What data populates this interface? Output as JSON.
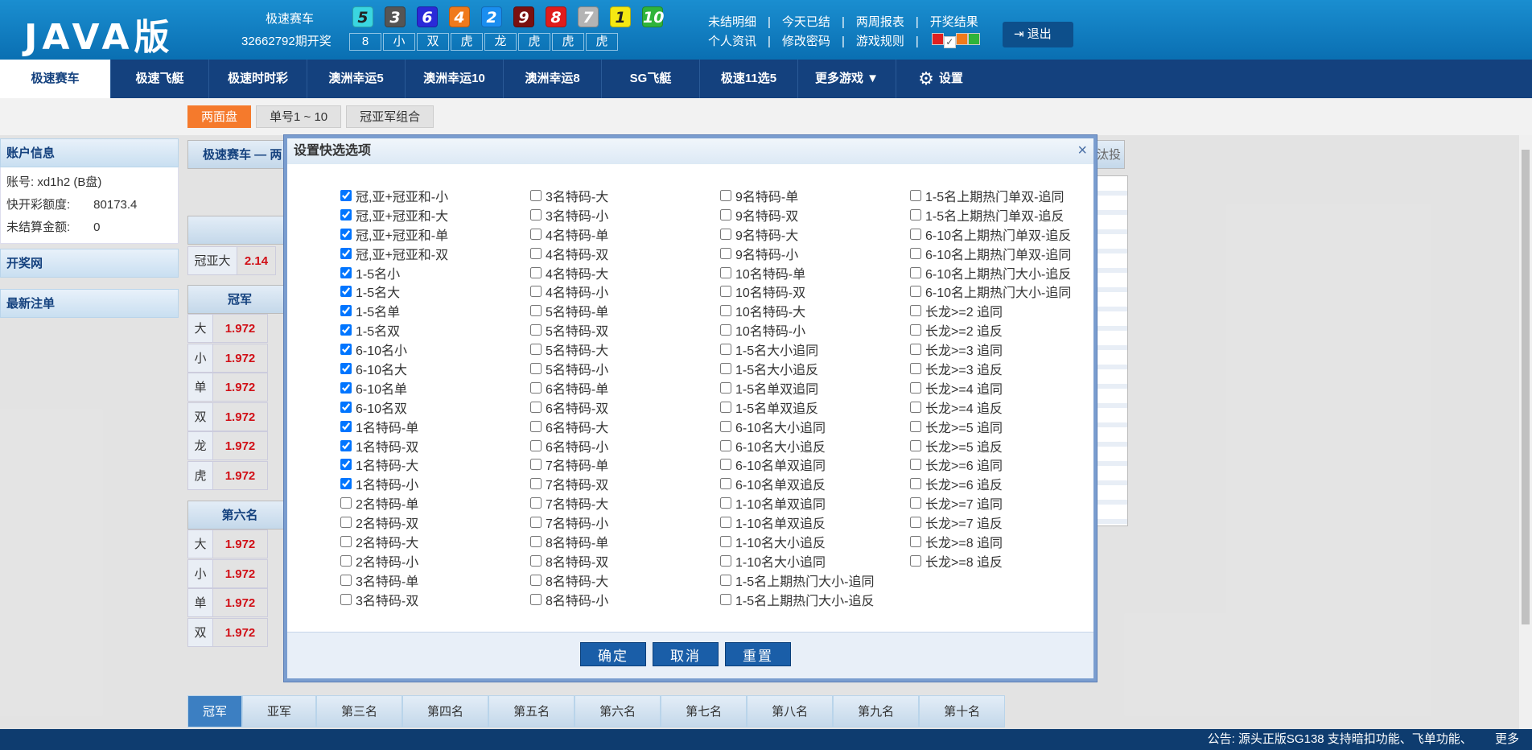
{
  "header": {
    "logo": "JAVA版",
    "game_name": "极速赛车",
    "draw_period": "32662792期开奖",
    "balls": [
      {
        "n": "5",
        "color": "#3ad6e0"
      },
      {
        "n": "3",
        "color": "#555555"
      },
      {
        "n": "6",
        "color": "#2a2ad8"
      },
      {
        "n": "4",
        "color": "#f07a1c"
      },
      {
        "n": "2",
        "color": "#1a8ef0"
      },
      {
        "n": "9",
        "color": "#7a1010"
      },
      {
        "n": "8",
        "color": "#e01c1c"
      },
      {
        "n": "7",
        "color": "#b4b4b4"
      },
      {
        "n": "1",
        "color": "#f5e812"
      },
      {
        "n": "10",
        "color": "#2fb43a"
      }
    ],
    "results": [
      "8",
      "小",
      "双",
      "虎",
      "龙",
      "虎",
      "虎",
      "虎"
    ],
    "links_row1": [
      "未结明细",
      "今天已结",
      "两周报表",
      "开奖结果"
    ],
    "links_row2": [
      "个人资讯",
      "修改密码",
      "游戏规则"
    ],
    "swatch_colors": [
      "#e02020",
      "#ffffff",
      "#f07a1c",
      "#2fb43a"
    ],
    "logout_label": "退出"
  },
  "nav": {
    "items": [
      "极速赛车",
      "极速飞艇",
      "极速时时彩",
      "澳洲幸运5",
      "澳洲幸运10",
      "澳洲幸运8",
      "SG飞艇",
      "极速11选5",
      "更多游戏 ▼"
    ],
    "settings_label": "设置"
  },
  "subtabs": [
    "两面盘",
    "单号1 ~ 10",
    "冠亚军组合"
  ],
  "sidebar": {
    "account_title": "账户信息",
    "account_label": "账号:",
    "account_value": "xd1h2 (B盘)",
    "credit_label": "快开彩额度:",
    "credit_value": "80173.4",
    "unsettled_label": "未结算金额:",
    "unsettled_value": "0",
    "lottery_site": "开奖网",
    "latest_bets": "最新注单"
  },
  "background": {
    "breadcrumb": "极速赛车 — 两",
    "right_tag": "汰投",
    "guanya_da_label": "冠亚大",
    "guanya_da_value": "2.14",
    "champion": "冠军",
    "sixth": "第六名",
    "champ_rows": [
      {
        "k": "大",
        "v": "1.972"
      },
      {
        "k": "小",
        "v": "1.972"
      },
      {
        "k": "单",
        "v": "1.972"
      },
      {
        "k": "双",
        "v": "1.972"
      },
      {
        "k": "龙",
        "v": "1.972"
      },
      {
        "k": "虎",
        "v": "1.972"
      }
    ],
    "sixth_rows": [
      {
        "k": "大",
        "v": "1.972"
      },
      {
        "k": "小",
        "v": "1.972"
      },
      {
        "k": "单",
        "v": "1.972"
      },
      {
        "k": "双",
        "v": "1.972"
      }
    ]
  },
  "bottom_tabs": [
    "冠军",
    "亚军",
    "第三名",
    "第四名",
    "第五名",
    "第六名",
    "第七名",
    "第八名",
    "第九名",
    "第十名"
  ],
  "status": {
    "notice": "公告: 源头正版SG138 支持暗扣功能、飞单功能、",
    "more": "更多"
  },
  "modal": {
    "title": "设置快选选项",
    "close": "×",
    "columns": [
      [
        {
          "label": "冠,亚+冠亚和-小",
          "checked": true
        },
        {
          "label": "冠,亚+冠亚和-大",
          "checked": true
        },
        {
          "label": "冠,亚+冠亚和-单",
          "checked": true
        },
        {
          "label": "冠,亚+冠亚和-双",
          "checked": true
        },
        {
          "label": "1-5名小",
          "checked": true
        },
        {
          "label": "1-5名大",
          "checked": true
        },
        {
          "label": "1-5名单",
          "checked": true
        },
        {
          "label": "1-5名双",
          "checked": true
        },
        {
          "label": "6-10名小",
          "checked": true
        },
        {
          "label": "6-10名大",
          "checked": true
        },
        {
          "label": "6-10名单",
          "checked": true
        },
        {
          "label": "6-10名双",
          "checked": true
        },
        {
          "label": "1名特码-单",
          "checked": true
        },
        {
          "label": "1名特码-双",
          "checked": true
        },
        {
          "label": "1名特码-大",
          "checked": true
        },
        {
          "label": "1名特码-小",
          "checked": true
        },
        {
          "label": "2名特码-单",
          "checked": false
        },
        {
          "label": "2名特码-双",
          "checked": false
        },
        {
          "label": "2名特码-大",
          "checked": false
        },
        {
          "label": "2名特码-小",
          "checked": false
        },
        {
          "label": "3名特码-单",
          "checked": false
        },
        {
          "label": "3名特码-双",
          "checked": false
        }
      ],
      [
        {
          "label": "3名特码-大",
          "checked": false
        },
        {
          "label": "3名特码-小",
          "checked": false
        },
        {
          "label": "4名特码-单",
          "checked": false
        },
        {
          "label": "4名特码-双",
          "checked": false
        },
        {
          "label": "4名特码-大",
          "checked": false
        },
        {
          "label": "4名特码-小",
          "checked": false
        },
        {
          "label": "5名特码-单",
          "checked": false
        },
        {
          "label": "5名特码-双",
          "checked": false
        },
        {
          "label": "5名特码-大",
          "checked": false
        },
        {
          "label": "5名特码-小",
          "checked": false
        },
        {
          "label": "6名特码-单",
          "checked": false
        },
        {
          "label": "6名特码-双",
          "checked": false
        },
        {
          "label": "6名特码-大",
          "checked": false
        },
        {
          "label": "6名特码-小",
          "checked": false
        },
        {
          "label": "7名特码-单",
          "checked": false
        },
        {
          "label": "7名特码-双",
          "checked": false
        },
        {
          "label": "7名特码-大",
          "checked": false
        },
        {
          "label": "7名特码-小",
          "checked": false
        },
        {
          "label": "8名特码-单",
          "checked": false
        },
        {
          "label": "8名特码-双",
          "checked": false
        },
        {
          "label": "8名特码-大",
          "checked": false
        },
        {
          "label": "8名特码-小",
          "checked": false
        }
      ],
      [
        {
          "label": "9名特码-单",
          "checked": false
        },
        {
          "label": "9名特码-双",
          "checked": false
        },
        {
          "label": "9名特码-大",
          "checked": false
        },
        {
          "label": "9名特码-小",
          "checked": false
        },
        {
          "label": "10名特码-单",
          "checked": false
        },
        {
          "label": "10名特码-双",
          "checked": false
        },
        {
          "label": "10名特码-大",
          "checked": false
        },
        {
          "label": "10名特码-小",
          "checked": false
        },
        {
          "label": "1-5名大小追同",
          "checked": false
        },
        {
          "label": "1-5名大小追反",
          "checked": false
        },
        {
          "label": "1-5名单双追同",
          "checked": false
        },
        {
          "label": "1-5名单双追反",
          "checked": false
        },
        {
          "label": "6-10名大小追同",
          "checked": false
        },
        {
          "label": "6-10名大小追反",
          "checked": false
        },
        {
          "label": "6-10名单双追同",
          "checked": false
        },
        {
          "label": "6-10名单双追反",
          "checked": false
        },
        {
          "label": "1-10名单双追同",
          "checked": false
        },
        {
          "label": "1-10名单双追反",
          "checked": false
        },
        {
          "label": "1-10名大小追反",
          "checked": false
        },
        {
          "label": "1-10名大小追同",
          "checked": false
        },
        {
          "label": "1-5名上期热门大小-追同",
          "checked": false
        },
        {
          "label": "1-5名上期热门大小-追反",
          "checked": false
        }
      ],
      [
        {
          "label": "1-5名上期热门单双-追同",
          "checked": false
        },
        {
          "label": "1-5名上期热门单双-追反",
          "checked": false
        },
        {
          "label": "6-10名上期热门单双-追反",
          "checked": false
        },
        {
          "label": "6-10名上期热门单双-追同",
          "checked": false
        },
        {
          "label": "6-10名上期热门大小-追反",
          "checked": false
        },
        {
          "label": "6-10名上期热门大小-追同",
          "checked": false
        },
        {
          "label": "长龙>=2 追同",
          "checked": false
        },
        {
          "label": "长龙>=2 追反",
          "checked": false
        },
        {
          "label": "长龙>=3 追同",
          "checked": false
        },
        {
          "label": "长龙>=3 追反",
          "checked": false
        },
        {
          "label": "长龙>=4 追同",
          "checked": false
        },
        {
          "label": "长龙>=4 追反",
          "checked": false
        },
        {
          "label": "长龙>=5 追同",
          "checked": false
        },
        {
          "label": "长龙>=5 追反",
          "checked": false
        },
        {
          "label": "长龙>=6 追同",
          "checked": false
        },
        {
          "label": "长龙>=6 追反",
          "checked": false
        },
        {
          "label": "长龙>=7 追同",
          "checked": false
        },
        {
          "label": "长龙>=7 追反",
          "checked": false
        },
        {
          "label": "长龙>=8 追同",
          "checked": false
        },
        {
          "label": "长龙>=8 追反",
          "checked": false
        }
      ]
    ],
    "confirm": "确定",
    "cancel": "取消",
    "reset": "重置"
  }
}
